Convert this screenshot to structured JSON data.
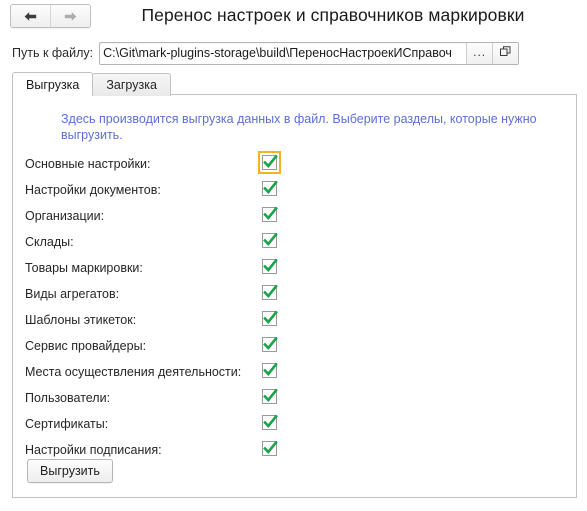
{
  "window": {
    "title": "Перенос настроек и справочников маркировки"
  },
  "nav": {
    "back_icon": "arrow-left-icon",
    "forward_icon": "arrow-right-icon"
  },
  "path_row": {
    "label": "Путь к файлу:",
    "value": "C:\\Git\\mark-plugins-storage\\build\\ПереносНастроекИСправоч",
    "placeholder": "",
    "browse_label": "...",
    "open_icon": "open-external-icon"
  },
  "tabs": [
    {
      "label": "Выгрузка",
      "active": true
    },
    {
      "label": "Загрузка",
      "active": false
    }
  ],
  "panel": {
    "hint": "Здесь производится выгрузка данных в файл. Выберите разделы, которые нужно выгрузить.",
    "hint_color": "#5b6fd8",
    "checkbox_check_color": "#19a34a",
    "focus_ring_color": "#f5b31c",
    "items": [
      {
        "label": "Основные настройки:",
        "checked": true,
        "focused": true
      },
      {
        "label": "Настройки документов:",
        "checked": true,
        "focused": false
      },
      {
        "label": "Организации:",
        "checked": true,
        "focused": false
      },
      {
        "label": "Склады:",
        "checked": true,
        "focused": false
      },
      {
        "label": "Товары маркировки:",
        "checked": true,
        "focused": false
      },
      {
        "label": "Виды агрегатов:",
        "checked": true,
        "focused": false
      },
      {
        "label": "Шаблоны этикеток:",
        "checked": true,
        "focused": false
      },
      {
        "label": "Сервис провайдеры:",
        "checked": true,
        "focused": false
      },
      {
        "label": "Места осуществления деятельности:",
        "checked": true,
        "focused": false
      },
      {
        "label": "Пользователи:",
        "checked": true,
        "focused": false
      },
      {
        "label": "Сертификаты:",
        "checked": true,
        "focused": false
      },
      {
        "label": "Настройки подписания:",
        "checked": true,
        "focused": false
      }
    ],
    "submit_label": "Выгрузить"
  }
}
